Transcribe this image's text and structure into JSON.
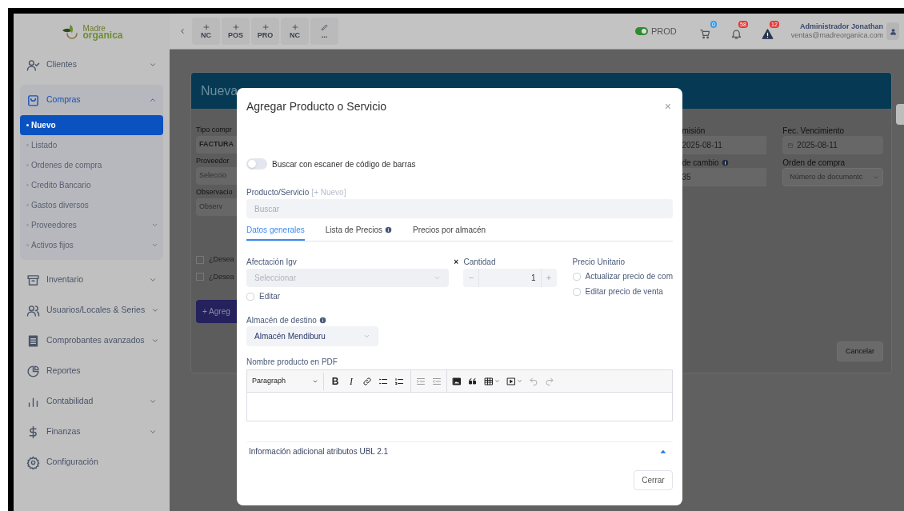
{
  "logo": {
    "line1": "Madre",
    "line2": "organica"
  },
  "header": {
    "quick_actions": [
      {
        "kind": "add",
        "label": "NC"
      },
      {
        "kind": "add",
        "label": "POS"
      },
      {
        "kind": "add",
        "label": "PRO"
      },
      {
        "kind": "add",
        "label": "NC"
      },
      {
        "kind": "edit",
        "label": "..."
      }
    ],
    "environment": {
      "label": "PROD",
      "on": true
    },
    "indicators": [
      {
        "kind": "cart",
        "count": "0",
        "color": "#3b9be8"
      },
      {
        "kind": "bell",
        "count": "58",
        "color": "#e53935"
      },
      {
        "kind": "warning",
        "count": "12",
        "color": "#e53935"
      }
    ],
    "user": {
      "name": "Administrador Jonathan",
      "email": "ventas@madreorganica.com"
    }
  },
  "sidebar": {
    "items": [
      {
        "label": "Clientes",
        "submenu": true,
        "expanded": false
      },
      {
        "label": "Compras",
        "submenu": true,
        "expanded": true,
        "children": [
          {
            "label": "Nuevo",
            "selected": true,
            "submenu": false
          },
          {
            "label": "Listado",
            "selected": false,
            "submenu": false
          },
          {
            "label": "Ordenes de compra",
            "selected": false,
            "submenu": false
          },
          {
            "label": "Credito Bancario",
            "selected": false,
            "submenu": false
          },
          {
            "label": "Gastos diversos",
            "selected": false,
            "submenu": false
          },
          {
            "label": "Proveedores",
            "selected": false,
            "submenu": true
          },
          {
            "label": "Activos fijos",
            "selected": false,
            "submenu": true
          }
        ]
      },
      {
        "label": "Inventario",
        "submenu": true,
        "expanded": false
      },
      {
        "label": "Usuarios/Locales & Series",
        "submenu": true,
        "expanded": false
      },
      {
        "label": "Comprobantes avanzados",
        "submenu": true,
        "expanded": false
      },
      {
        "label": "Reportes",
        "submenu": false,
        "expanded": false
      },
      {
        "label": "Contabilidad",
        "submenu": true,
        "expanded": false
      },
      {
        "label": "Finanzas",
        "submenu": true,
        "expanded": false
      },
      {
        "label": "Configuración",
        "submenu": false,
        "expanded": false
      }
    ]
  },
  "background_form": {
    "title": "Nueva",
    "left": [
      {
        "kind": "label",
        "text": "Tipo compr"
      },
      {
        "kind": "value",
        "text": "FACTURA"
      },
      {
        "kind": "label",
        "text": "Proveedor"
      },
      {
        "kind": "placeholder",
        "text": "Seleccio"
      },
      {
        "kind": "label",
        "text": "Observacio"
      },
      {
        "kind": "placeholder",
        "text": "Observ"
      }
    ],
    "checks": [
      {
        "label": "¿Desea",
        "checked": false
      },
      {
        "label": "¿Desea",
        "checked": false
      }
    ],
    "add_button": "+ Agreg",
    "right_columns": [
      [
        {
          "kind": "label",
          "text": "misión"
        },
        {
          "kind": "value",
          "text": "2025-08-11"
        },
        {
          "kind": "label_info",
          "text": "de cambio"
        },
        {
          "kind": "value",
          "text": "35"
        }
      ],
      [
        {
          "kind": "label",
          "text": "Fec. Vencimiento"
        },
        {
          "kind": "date",
          "text": "2025-08-11"
        },
        {
          "kind": "label",
          "text": "Orden de compra"
        },
        {
          "kind": "select",
          "text": "Número de documentc"
        }
      ]
    ],
    "cancel_button": "Cancelar"
  },
  "modal": {
    "title": "Agregar Producto o Servicio",
    "close": "×",
    "scanner_toggle": {
      "label": "Buscar con escaner de código de barras",
      "on": false
    },
    "product": {
      "label": "Producto/Servicio",
      "link": "[+ Nuevo]",
      "placeholder": "Buscar"
    },
    "tabs": [
      {
        "label": "Datos generales",
        "selected": true,
        "info": false
      },
      {
        "label": "Lista de Precios",
        "selected": false,
        "info": true
      },
      {
        "label": "Precios por almacén",
        "selected": false,
        "info": false
      }
    ],
    "igv": {
      "label": "Afectación Igv",
      "placeholder": "Seleccionar",
      "disabled": true,
      "edit": {
        "label": "Editar",
        "checked": false
      }
    },
    "multiply": "×",
    "quantity": {
      "label": "Cantidad",
      "value": "1",
      "minus": "−",
      "plus": "+"
    },
    "price": {
      "label": "Precio Unitario",
      "options": [
        {
          "label": "Actualizar precio de com",
          "checked": false
        },
        {
          "label": "Editar precio de venta",
          "checked": false
        }
      ]
    },
    "warehouse": {
      "label": "Almacén de destino",
      "value": "Almacén Mendiburu"
    },
    "pdf_name": {
      "label": "Nombre producto en PDF",
      "block_format": "Paragraph",
      "bold": "B",
      "italic": "I"
    },
    "accordion": {
      "label": "Información adicional atributos UBL 2.1",
      "expanded": true
    },
    "close_button": "Cerrar"
  }
}
